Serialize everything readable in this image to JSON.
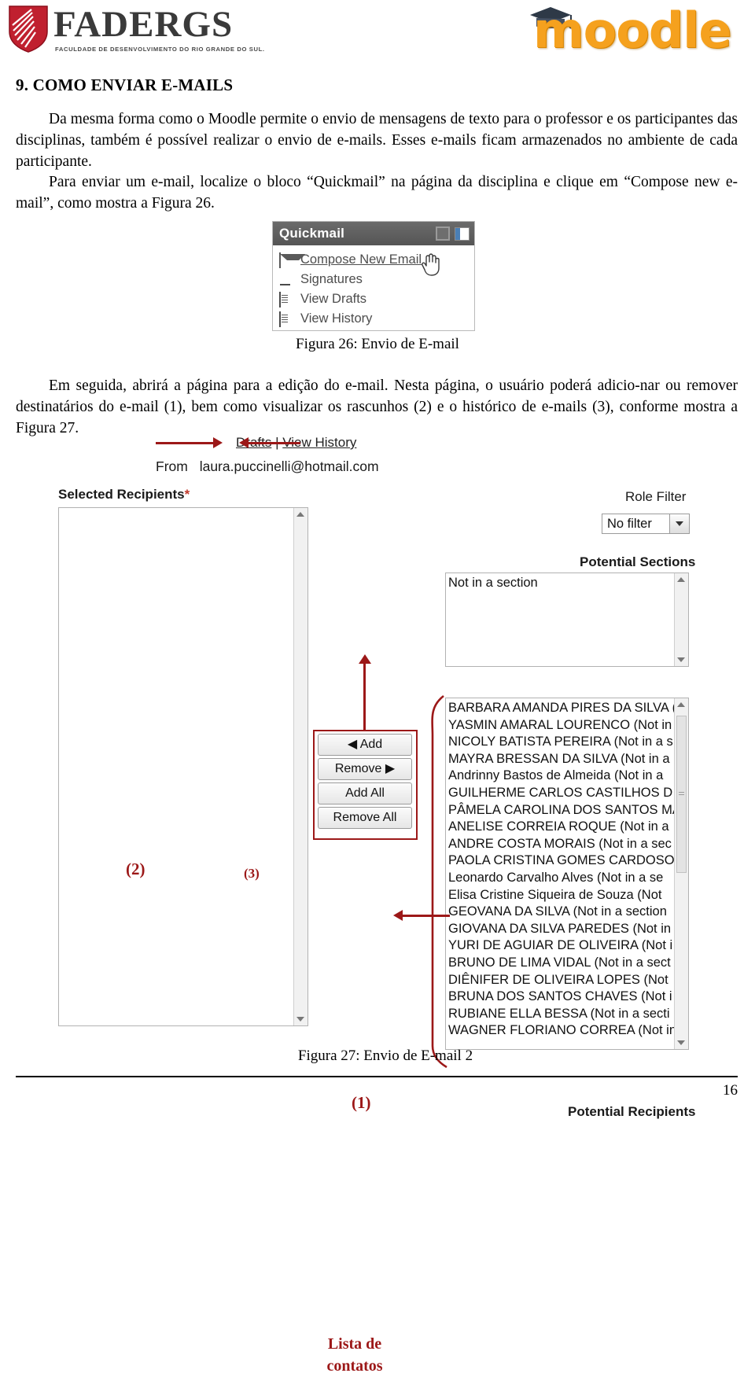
{
  "header": {
    "fadergs": {
      "wordmark": "FADERGS",
      "tagline": "FACULDADE DE DESENVOLVIMENTO DO RIO GRANDE DO SUL.",
      "shield_color": "#c0202f"
    },
    "moodle": {
      "wordmark": "moodle",
      "color": "#f5a11e"
    }
  },
  "section": {
    "heading": "9. COMO ENVIAR E-MAILS",
    "paragraph_1": "Da mesma forma como o Moodle permite o envio de mensagens de texto para o professor e os participantes das disciplinas, também é possível realizar o envio de e-mails. Esses e-mails ficam armazenados no ambiente de cada participante.",
    "paragraph_2": "Para enviar um e-mail, localize o bloco “Quickmail” na página da disciplina e clique em “Compose new e-mail”, como mostra a Figura 26.",
    "paragraph_3": "Em seguida, abrirá a página para a edição do e-mail. Nesta página, o usuário poderá adicio-nar ou remover destinatários do e-mail (1), bem como visualizar os rascunhos (2) e o histórico de e-mails (3), conforme mostra a Figura 27."
  },
  "figure_26": {
    "caption": "Figura 26: Envio de E-mail",
    "block": {
      "title": "Quickmail",
      "header_icons": [
        "square-icon",
        "dock-block-icon"
      ],
      "items": [
        {
          "label": "Compose New Email",
          "icon": "envelope-icon",
          "is_link": true
        },
        {
          "label": "Signatures",
          "icon": "pen-icon",
          "is_link": false
        },
        {
          "label": "View Drafts",
          "icon": "document-icon",
          "is_link": false
        },
        {
          "label": "View History",
          "icon": "document-icon",
          "is_link": false
        }
      ],
      "cursor": "hand-cursor"
    }
  },
  "figure_27": {
    "caption": "Figura 27: Envio de E-mail 2",
    "top_links": {
      "drafts": "Drafts",
      "separator": "|",
      "history": "View History"
    },
    "from": {
      "label": "From",
      "email": "laura.puccinelli@hotmail.com"
    },
    "selected_recipients": {
      "label": "Selected Recipients",
      "required_mark": "*",
      "items": []
    },
    "role_filter": {
      "label": "Role Filter",
      "selected": "No filter",
      "options": [
        "No filter"
      ]
    },
    "potential_sections": {
      "label": "Potential Sections",
      "items": [
        "Not in a section"
      ]
    },
    "potential_recipients": {
      "label": "Potential Recipients",
      "items": [
        "BARBARA AMANDA PIRES DA SILVA (",
        "YASMIN AMARAL LOURENCO (Not in",
        "NICOLY BATISTA PEREIRA (Not in a s",
        "MAYRA BRESSAN DA SILVA (Not in a",
        "Andrinny Bastos de Almeida (Not in a",
        "GUILHERME CARLOS CASTILHOS D",
        "PÂMELA CAROLINA DOS SANTOS MA",
        "ANELISE CORREIA ROQUE (Not in a",
        "ANDRE COSTA MORAIS (Not in a sec",
        "PAOLA CRISTINA GOMES CARDOSO",
        "Leonardo Carvalho Alves (Not in a se",
        "Elisa Cristine Siqueira de Souza (Not",
        "GEOVANA DA SILVA (Not in a section",
        "GIOVANA DA SILVA PAREDES (Not in",
        "YURI DE AGUIAR DE OLIVEIRA (Not i",
        "BRUNO DE LIMA VIDAL (Not in a sect",
        "DIÊNIFER DE OLIVEIRA LOPES (Not",
        "BRUNA DOS SANTOS CHAVES (Not i",
        "RUBIANE ELLA BESSA (Not in a secti",
        "WAGNER FLORIANO CORREA (Not in"
      ]
    },
    "buttons": [
      "◀ Add",
      "Remove ▶",
      "Add All",
      "Remove All"
    ],
    "annotations": {
      "one": "(1)",
      "two": "(2)",
      "three": "(3)",
      "lista_contatos": "Lista de contatos",
      "color": "#9c1818"
    }
  },
  "page": {
    "number": "16"
  }
}
